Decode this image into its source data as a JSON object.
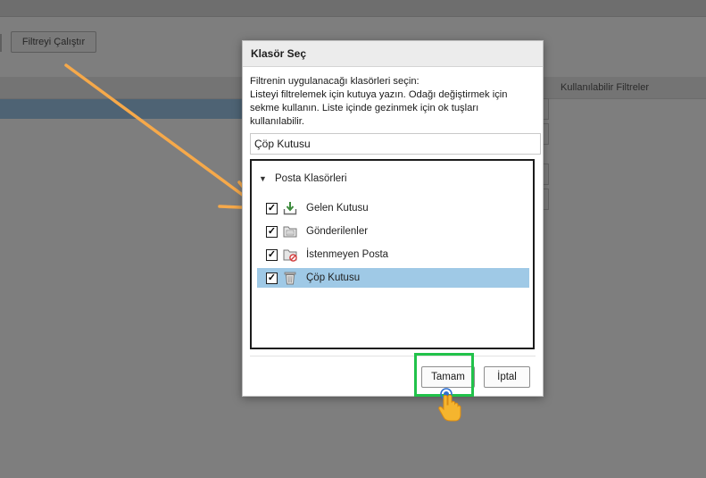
{
  "background": {
    "run_filter_button": "Filtreyi Çalıştır",
    "available_filters_header": "Kullanılabilir Filtreler"
  },
  "dialog": {
    "title": "Klasör Seç",
    "instructions": [
      "Filtrenin uygulanacağı klasörleri seçin:",
      "Listeyi filtrelemek için kutuya yazın. Odağı değiştirmek için",
      "sekme kullanın. Liste içinde gezinmek için ok tuşları",
      "kullanılabilir."
    ],
    "filter_value": "Çöp Kutusu",
    "tree": {
      "root_label": "Posta Klasörleri",
      "items": [
        {
          "label": "Gelen Kutusu",
          "checked": true,
          "icon": "inbox-download-icon",
          "selected": false
        },
        {
          "label": "Gönderilenler",
          "checked": true,
          "icon": "sent-folder-icon",
          "selected": false
        },
        {
          "label": "İstenmeyen Posta",
          "checked": true,
          "icon": "junk-folder-icon",
          "selected": false
        },
        {
          "label": "Çöp Kutusu",
          "checked": true,
          "icon": "trash-icon",
          "selected": true
        }
      ]
    },
    "ok_label": "Tamam",
    "cancel_label": "İptal"
  },
  "colors": {
    "highlight_box": "#21c24a",
    "arrow": "#f6a94a",
    "selection": "#9fc9e6",
    "pointer_hand": "#f5b52e"
  }
}
